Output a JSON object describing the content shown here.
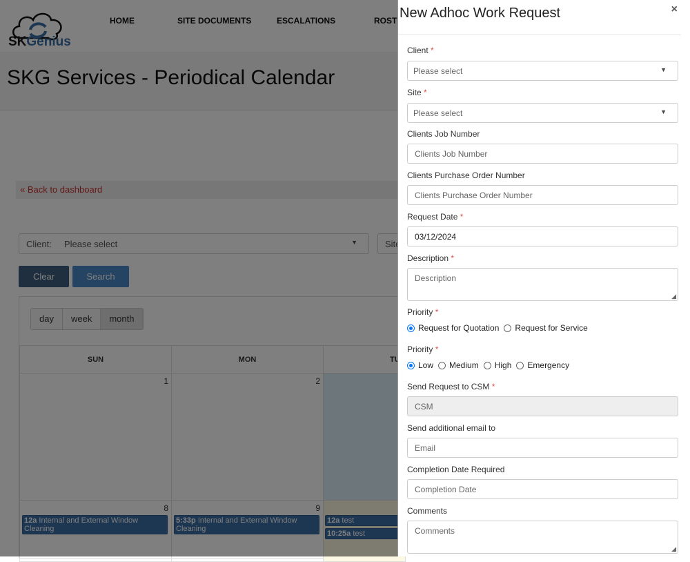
{
  "header": {
    "brand": {
      "sk": "SK",
      "genius": "Genius"
    },
    "nav": [
      "HOME",
      "SITE DOCUMENTS",
      "ESCALATIONS",
      "ROST"
    ]
  },
  "page": {
    "title": "SKG Services - Periodical Calendar",
    "back_link": "« Back to dashboard"
  },
  "filters": {
    "client_label": "Client:",
    "client_value": "Please select",
    "site_label": "Site"
  },
  "buttons": {
    "clear": "Clear",
    "search": "Search"
  },
  "calendar": {
    "views": [
      "day",
      "week",
      "month"
    ],
    "active_view": "month",
    "days_of_week": [
      "SUN",
      "MON",
      "TU"
    ],
    "row1": [
      "1",
      "2"
    ],
    "row2": [
      "8",
      "9"
    ],
    "events": [
      {
        "day": "8",
        "time": "12a",
        "title": "Internal and External Window Cleaning"
      },
      {
        "day": "9",
        "time": "5:33p",
        "title": "Internal and External Window Cleaning"
      },
      {
        "day": "10",
        "time": "12a",
        "title": "test"
      },
      {
        "day": "10",
        "time": "10:25a",
        "title": "test"
      }
    ]
  },
  "modal": {
    "title": "New Adhoc Work Request",
    "close": "×",
    "client": {
      "label": "Client",
      "placeholder": "Please select"
    },
    "site": {
      "label": "Site",
      "placeholder": "Please select"
    },
    "job_number": {
      "label": "Clients Job Number",
      "placeholder": "Clients Job Number"
    },
    "po_number": {
      "label": "Clients Purchase Order Number",
      "placeholder": "Clients Purchase Order Number"
    },
    "request_date": {
      "label": "Request Date",
      "value": "03/12/2024"
    },
    "description": {
      "label": "Description",
      "placeholder": "Description"
    },
    "priority_type": {
      "label": "Priority",
      "options": [
        "Request for Quotation",
        "Request for Service"
      ],
      "selected": "Request for Quotation"
    },
    "priority_level": {
      "label": "Priority",
      "options": [
        "Low",
        "Medium",
        "High",
        "Emergency"
      ],
      "selected": "Low"
    },
    "csm": {
      "label": "Send Request to CSM",
      "placeholder": "CSM"
    },
    "email": {
      "label": "Send additional email to",
      "placeholder": "Email"
    },
    "completion": {
      "label": "Completion Date Required",
      "placeholder": "Completion Date"
    },
    "comments": {
      "label": "Comments",
      "placeholder": "Comments"
    },
    "required_mark": "*"
  },
  "colors": {
    "event": "#3a6ea5",
    "required": "#d9534f",
    "link": "#c9302c",
    "search_btn": "#4a86c5",
    "clear_btn": "#3f5f80"
  }
}
